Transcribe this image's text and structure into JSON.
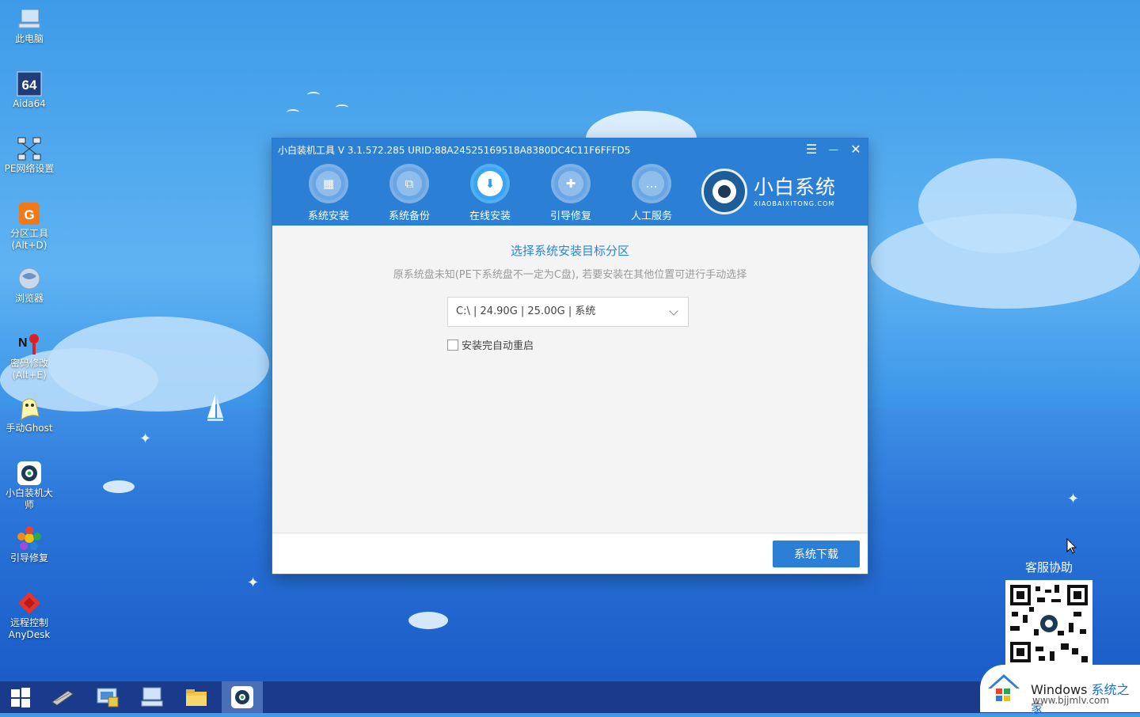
{
  "desktop": {
    "icons": [
      {
        "label": "此电脑",
        "icon": "computer-icon"
      },
      {
        "label": "Aida64",
        "icon": "aida64-icon"
      },
      {
        "label": "PE网络设置",
        "icon": "network-icon"
      },
      {
        "label": "分区工具\n(Alt+D)",
        "icon": "partition-tool-icon"
      },
      {
        "label": "浏览器",
        "icon": "browser-icon"
      },
      {
        "label": "密码修改\n(Alt+E)",
        "icon": "password-icon"
      },
      {
        "label": "手动Ghost",
        "icon": "ghost-icon"
      },
      {
        "label": "小白装机大\n师",
        "icon": "xiaobai-icon"
      },
      {
        "label": "引导修复",
        "icon": "boot-repair-icon"
      },
      {
        "label": "远程控制\nAnyDesk",
        "icon": "anydesk-icon"
      }
    ]
  },
  "window": {
    "title": "小白装机工具 V 3.1.572.285 URID:88A24525169518A8380DC4C11F6FFFD5",
    "menu_glyph": "☰",
    "min_glyph": "—",
    "close_glyph": "✕",
    "nav": [
      {
        "label": "系统安装",
        "glyph": "▦",
        "active": false
      },
      {
        "label": "系统备份",
        "glyph": "⧉",
        "active": false
      },
      {
        "label": "在线安装",
        "glyph": "⬇",
        "active": true
      },
      {
        "label": "引导修复",
        "glyph": "✚",
        "active": false
      },
      {
        "label": "人工服务",
        "glyph": "…",
        "active": false
      }
    ],
    "brand": {
      "name": "小白系统",
      "domain": "XIAOBAIXITONG.COM"
    },
    "content": {
      "title": "选择系统安装目标分区",
      "subtitle": "原系统盘未知(PE下系统盘不一定为C盘), 若要安装在其他位置可进行手动选择",
      "partition_value": "C:\\ | 24.90G | 25.00G | 系统",
      "auto_restart_label": "安装完自动重启",
      "auto_restart_checked": false
    },
    "download_button": "系统下载"
  },
  "support": {
    "label": "客服协助"
  },
  "watermark": {
    "brand": "Windows",
    "suffix": "系统之家",
    "url": "www.bjjmlv.com"
  },
  "colors": {
    "accent": "#2b80d6",
    "title_blue": "#2b86d6",
    "taskbar": "#1a3a8c"
  }
}
